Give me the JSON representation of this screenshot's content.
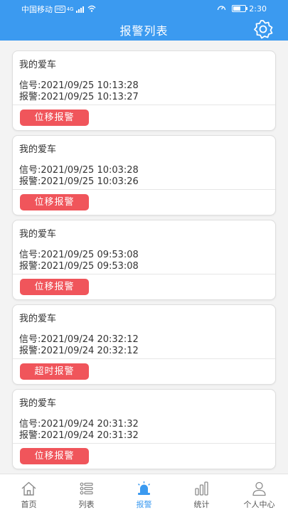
{
  "status_bar": {
    "carrier": "中国移动",
    "hd": "HD",
    "net": "4G",
    "speed": "0.00",
    "time": "2:30",
    "battery_level": 0.6
  },
  "header": {
    "title": "报警列表",
    "settings_icon": "gear-icon"
  },
  "alarms": [
    {
      "name": "我的爱车",
      "signal": "信号:2021/09/25 10:13:28",
      "alarm": "报警:2021/09/25 10:13:27",
      "tag": "位移报警"
    },
    {
      "name": "我的爱车",
      "signal": "信号:2021/09/25 10:03:28",
      "alarm": "报警:2021/09/25 10:03:26",
      "tag": "位移报警"
    },
    {
      "name": "我的爱车",
      "signal": "信号:2021/09/25 09:53:08",
      "alarm": "报警:2021/09/25 09:53:08",
      "tag": "位移报警"
    },
    {
      "name": "我的爱车",
      "signal": "信号:2021/09/24 20:32:12",
      "alarm": "报警:2021/09/24 20:32:12",
      "tag": "超时报警"
    },
    {
      "name": "我的爱车",
      "signal": "信号:2021/09/24 20:31:32",
      "alarm": "报警:2021/09/24 20:31:32",
      "tag": "位移报警"
    }
  ],
  "tabs": [
    {
      "label": "首页",
      "icon": "home-icon"
    },
    {
      "label": "列表",
      "icon": "list-icon"
    },
    {
      "label": "报警",
      "icon": "alarm-light-icon",
      "active": true
    },
    {
      "label": "统计",
      "icon": "bar-chart-icon"
    },
    {
      "label": "个人中心",
      "icon": "user-icon"
    }
  ],
  "colors": {
    "header_bg": "#3b9af0",
    "tag_bg": "#f0555b",
    "active_tab": "#3b9af0",
    "inactive_tab": "#555555"
  }
}
